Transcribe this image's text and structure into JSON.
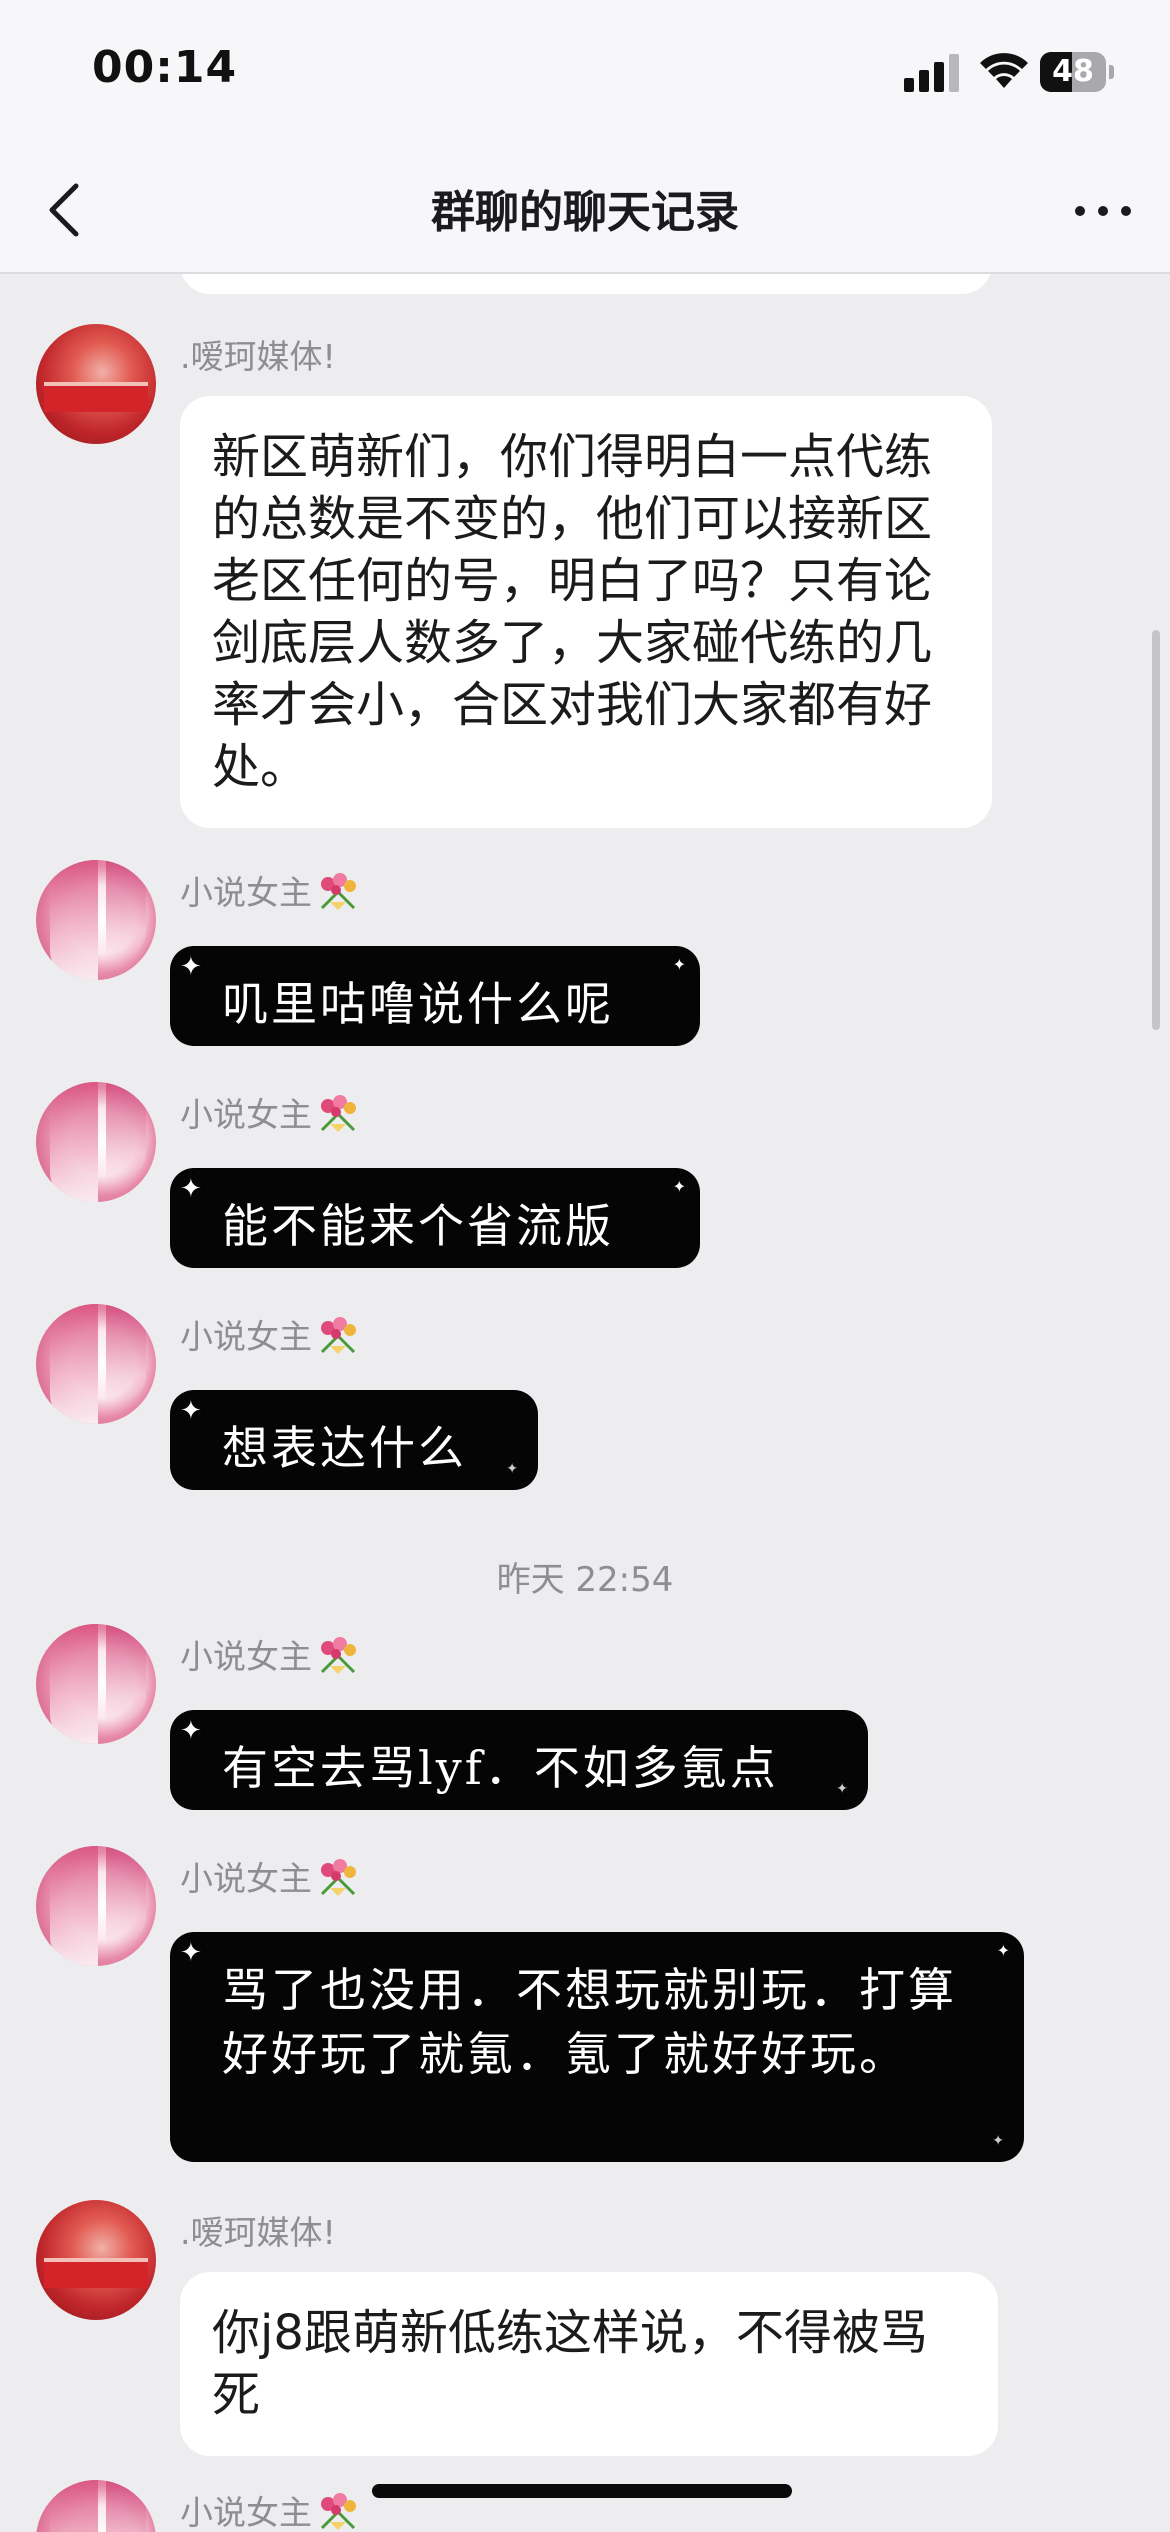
{
  "status_bar": {
    "time": "00:14",
    "battery_level": "48",
    "battery_fraction": 0.48,
    "signal_bars_active": 3,
    "icons": [
      "signal-icon",
      "wifi-icon",
      "battery-icon"
    ]
  },
  "nav": {
    "title": "群聊的聊天记录",
    "back_icon": "chevron-left-icon",
    "more_icon": "more-icon"
  },
  "messages": [
    {
      "sender": ".嗳珂媒体!",
      "avatar": "avatar-red",
      "style": "white",
      "text": "新区萌新们，你们得明白一点代练的总数是不变的，他们可以接新区老区任何的号，明白了吗？只有论剑底层人数多了，大家碰代练的几率才会小，合区对我们大家都有好处。"
    },
    {
      "sender": "小说女主",
      "avatar": "avatar-pink",
      "style": "black",
      "text": "叽里咕噜说什么呢"
    },
    {
      "sender": "小说女主",
      "avatar": "avatar-pink",
      "style": "black",
      "text": "能不能来个省流版"
    },
    {
      "sender": "小说女主",
      "avatar": "avatar-pink",
      "style": "black",
      "text": "想表达什么"
    },
    {
      "sender": "小说女主",
      "avatar": "avatar-pink",
      "style": "black",
      "text": "有空去骂lyf．不如多氪点"
    },
    {
      "sender": "小说女主",
      "avatar": "avatar-pink",
      "style": "black",
      "text": "骂了也没用．不想玩就别玩．打算好好玩了就氪．氪了就好好玩。"
    },
    {
      "sender": ".嗳珂媒体!",
      "avatar": "avatar-red",
      "style": "white",
      "text": "你j8跟萌新低练这样说，不得被骂死"
    },
    {
      "sender": "小说女主",
      "avatar": "avatar-pink",
      "style": "black",
      "text": ""
    }
  ],
  "timestamp_divider": "昨天 22:54",
  "colors": {
    "background": "#ededf0",
    "bar_background": "#f7f7f9",
    "white_bubble": "#ffffff",
    "black_bubble": "#050505",
    "meta_text": "#8d8d92"
  }
}
